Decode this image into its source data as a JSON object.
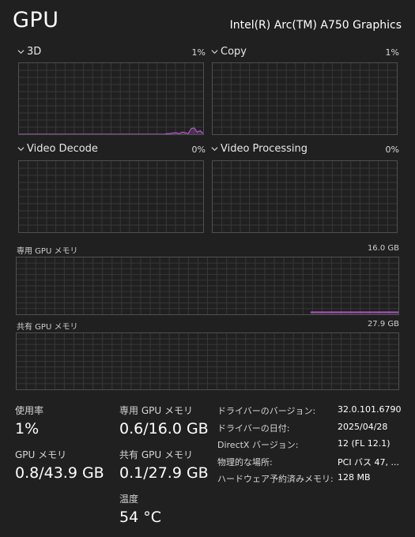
{
  "header": {
    "title": "GPU",
    "adapter_name": "Intel(R) Arc(TM) A750 Graphics"
  },
  "engines": [
    {
      "label": "3D",
      "percent": "1%",
      "usage_history": [
        0,
        0,
        0,
        0,
        0,
        0,
        0,
        0,
        0,
        0,
        0,
        0,
        0,
        0,
        0,
        0,
        0,
        0,
        0,
        0,
        0,
        0,
        0,
        0,
        0,
        0,
        0,
        0,
        0,
        0,
        0,
        0,
        0,
        0,
        0,
        0,
        0,
        0,
        0,
        0,
        0,
        0,
        0,
        0,
        0,
        0,
        0,
        0,
        0,
        0,
        1,
        1,
        2,
        2,
        1,
        3,
        2,
        1,
        8,
        9,
        3,
        5,
        1
      ]
    },
    {
      "label": "Copy",
      "percent": "1%",
      "usage_history": []
    },
    {
      "label": "Video Decode",
      "percent": "0%",
      "usage_history": []
    },
    {
      "label": "Video Processing",
      "percent": "0%",
      "usage_history": []
    }
  ],
  "dedicated_memory": {
    "label": "専用 GPU メモリ",
    "capacity": "16.0 GB",
    "usage_fraction": 0.0375,
    "activity_start_fraction": 0.77
  },
  "shared_memory": {
    "label": "共有 GPU メモリ",
    "capacity": "27.9 GB"
  },
  "stats": {
    "utilization": {
      "label": "使用率",
      "value": "1%"
    },
    "dedicated": {
      "label": "専用 GPU メモリ",
      "value": "0.6/16.0 GB"
    },
    "gpu_memory": {
      "label": "GPU メモリ",
      "value": "0.8/43.9 GB"
    },
    "shared": {
      "label": "共有 GPU メモリ",
      "value": "0.1/27.9 GB"
    },
    "temperature": {
      "label": "温度",
      "value": "54 °C"
    }
  },
  "properties": [
    {
      "key": "ドライバーのバージョン:",
      "value": "32.0.101.6790"
    },
    {
      "key": "ドライバーの日付:",
      "value": "2025/04/28"
    },
    {
      "key": "DirectX バージョン:",
      "value": "12 (FL 12.1)"
    },
    {
      "key": "物理的な場所:",
      "value": "PCI バス 47, ..."
    },
    {
      "key": "ハードウェア予約済みメモリ:",
      "value": "128 MB"
    }
  ],
  "colors": {
    "accent": "#b45ac8",
    "grid": "#383838",
    "border": "#505050"
  }
}
